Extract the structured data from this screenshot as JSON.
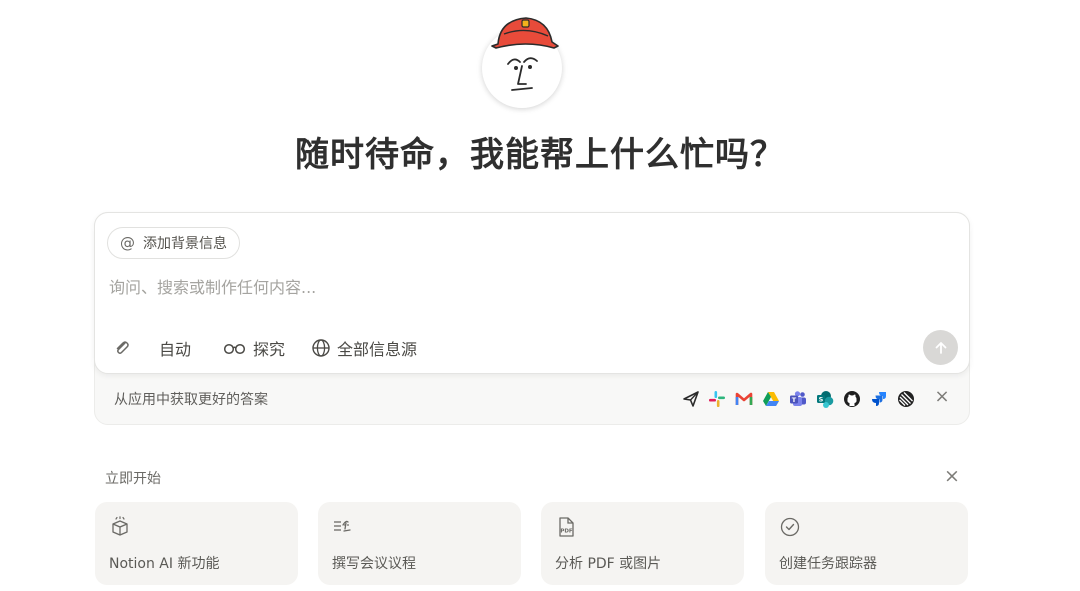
{
  "heading": "随时待命，我能帮上什么忙吗？",
  "prompt": {
    "context_chip": "添加背景信息",
    "context_symbol": "@",
    "placeholder": "询问、搜索或制作任何内容...",
    "tools": {
      "attach_icon": "paperclip-icon",
      "auto_label": "自动",
      "research_label": "探究",
      "sources_label": "全部信息源"
    },
    "send_icon": "arrow-up-icon"
  },
  "apps": {
    "text": "从应用中获取更好的答案",
    "icons": [
      "send-icon",
      "slack-icon",
      "gmail-icon",
      "google-drive-icon",
      "teams-icon",
      "sharepoint-icon",
      "github-icon",
      "jira-icon",
      "linear-icon"
    ],
    "close_symbol": "×"
  },
  "start": {
    "title": "立即开始",
    "close_symbol": "×",
    "cards": [
      {
        "label": "Notion AI 新功能",
        "icon": "gift-box-icon"
      },
      {
        "label": "撰写会议议程",
        "icon": "pen-lines-icon"
      },
      {
        "label": "分析 PDF 或图片",
        "icon": "pdf-file-icon"
      },
      {
        "label": "创建任务跟踪器",
        "icon": "check-circle-icon"
      }
    ]
  },
  "colors": {
    "accent_red": "#e84b3a",
    "send_button": "#d9d8d6",
    "card_bg": "#f5f4f2"
  }
}
